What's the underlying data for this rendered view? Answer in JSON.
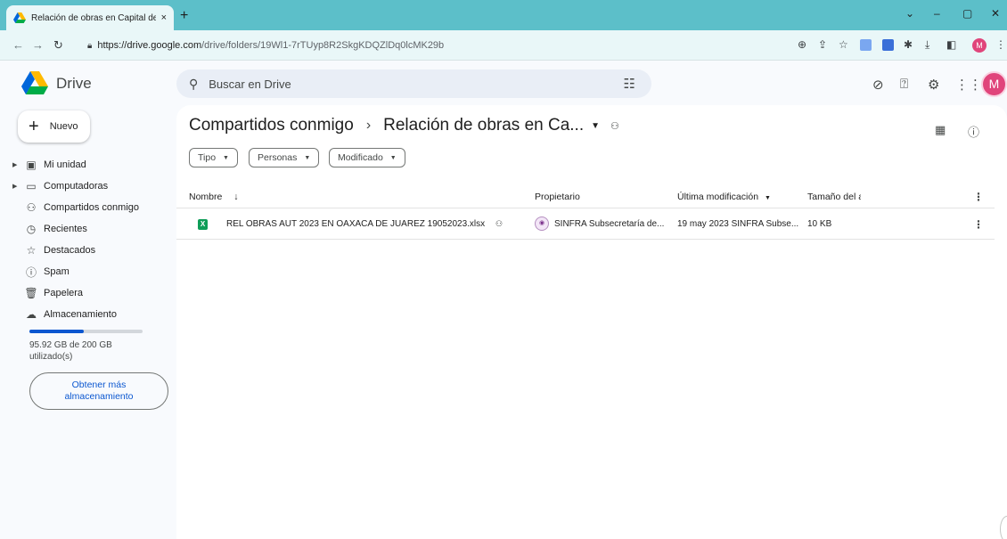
{
  "browser": {
    "tab_title": "Relación de obras en Capital de",
    "tab_close": "×",
    "new_tab": "+",
    "url_host": "https://drive.google.com",
    "url_path": "/drive/folders/19Wl1-7rTUyp8R2SkgKDQZlDq0lcMK29b",
    "profile_initial": "M"
  },
  "header": {
    "app_name": "Drive",
    "search_placeholder": "Buscar en Drive",
    "avatar_initial": "M"
  },
  "sidebar": {
    "new_label": "Nuevo",
    "items": [
      {
        "label": "Mi unidad",
        "icon": "my-drive-icon",
        "expandable": true
      },
      {
        "label": "Computadoras",
        "icon": "computer-icon",
        "expandable": true
      },
      {
        "label": "Compartidos conmigo",
        "icon": "shared-icon",
        "expandable": false
      },
      {
        "label": "Recientes",
        "icon": "clock-icon",
        "expandable": false
      },
      {
        "label": "Destacados",
        "icon": "star-icon",
        "expandable": false
      },
      {
        "label": "Spam",
        "icon": "spam-icon",
        "expandable": false
      },
      {
        "label": "Papelera",
        "icon": "trash-icon",
        "expandable": false
      },
      {
        "label": "Almacenamiento",
        "icon": "cloud-icon",
        "expandable": false
      }
    ],
    "storage_text": "95.92 GB de 200 GB utilizado(s)",
    "storage_fraction": 0.48,
    "more_storage_label": "Obtener más almacenamiento"
  },
  "main": {
    "breadcrumb_parent": "Compartidos conmigo",
    "breadcrumb_separator": "›",
    "breadcrumb_current": "Relación de obras en Ca...",
    "filters": [
      "Tipo",
      "Personas",
      "Modificado"
    ],
    "columns": {
      "name": "Nombre",
      "owner": "Propietario",
      "modified": "Última modificación",
      "size": "Tamaño del a"
    },
    "files": [
      {
        "name": "REL OBRAS AUT 2023 EN OAXACA DE JUAREZ 19052023.xlsx",
        "type_badge": "X",
        "owner": "SINFRA Subsecretaría de...",
        "modified": "19 may 2023 SINFRA Subse...",
        "size": "10 KB"
      }
    ]
  },
  "colors": {
    "tab_strip": "#5cbfc9",
    "toolbar": "#e9f7f8",
    "accent": "#0b57d0",
    "excel_green": "#0f9d58",
    "avatar": "#e0457b"
  }
}
